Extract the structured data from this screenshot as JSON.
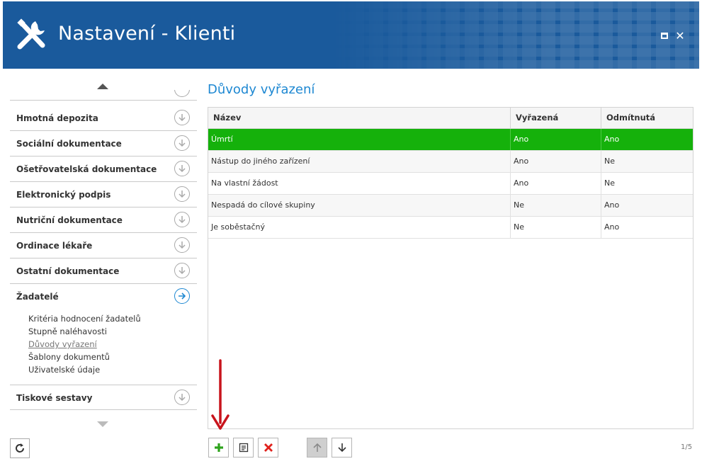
{
  "window": {
    "title": "Nastavení - Klienti"
  },
  "sidebar": {
    "items": [
      {
        "label": "Hmotná depozita"
      },
      {
        "label": "Sociální dokumentace"
      },
      {
        "label": "Ošetřovatelská dokumentace"
      },
      {
        "label": "Elektronický podpis"
      },
      {
        "label": "Nutriční dokumentace"
      },
      {
        "label": "Ordinace lékaře"
      },
      {
        "label": "Ostatní dokumentace"
      },
      {
        "label": "Žadatelé"
      },
      {
        "label": "Tiskové sestavy"
      }
    ],
    "subitems": [
      {
        "label": "Kritéria hodnocení žadatelů"
      },
      {
        "label": "Stupně naléhavosti"
      },
      {
        "label": "Důvody vyřazení"
      },
      {
        "label": "Šablony dokumentů"
      },
      {
        "label": "Uživatelské údaje"
      }
    ],
    "active_item": "Žadatelé",
    "selected_subitem": "Důvody vyřazení"
  },
  "main": {
    "title": "Důvody vyřazení",
    "columns": [
      "Název",
      "Vyřazená",
      "Odmítnutá"
    ],
    "rows": [
      {
        "name": "Úmrtí",
        "excluded": "Ano",
        "rejected": "Ano"
      },
      {
        "name": "Nástup do jiného zařízení",
        "excluded": "Ano",
        "rejected": "Ne"
      },
      {
        "name": "Na vlastní žádost",
        "excluded": "Ano",
        "rejected": "Ne"
      },
      {
        "name": "Nespadá do cílové skupiny",
        "excluded": "Ne",
        "rejected": "Ano"
      },
      {
        "name": "Je soběstačný",
        "excluded": "Ne",
        "rejected": "Ano"
      }
    ],
    "selected_row": 0
  },
  "toolbar": {
    "icons": [
      "plus-icon",
      "edit-icon",
      "delete-icon",
      "arrow-up-icon",
      "arrow-down-icon"
    ]
  },
  "pager": {
    "text": "1/5"
  },
  "colors": {
    "titlebar": "#1a5a9c",
    "accent": "#1e88d2",
    "selected_row": "#15b10b",
    "add": "#2fa31d",
    "delete": "#e0201b",
    "annotation_arrow": "#c8141c"
  }
}
